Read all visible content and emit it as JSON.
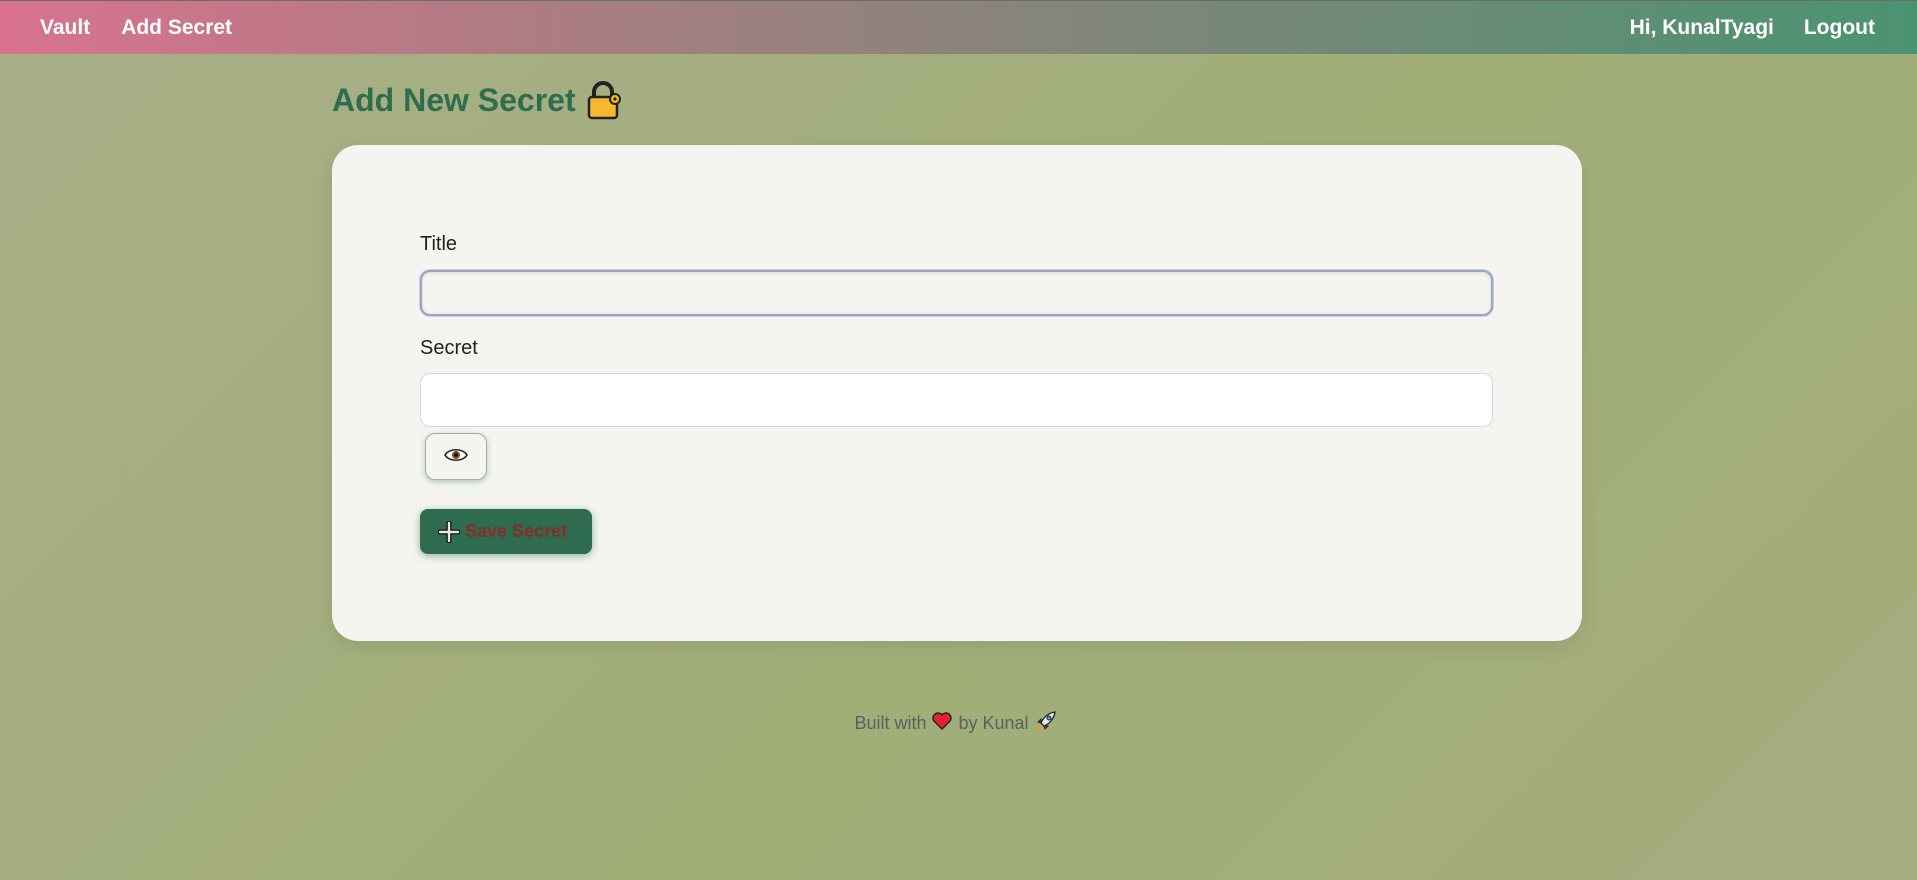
{
  "nav": {
    "vault_label": "Vault",
    "add_secret_label": "Add Secret",
    "greeting": "Hi, KunalTyagi",
    "logout_label": "Logout"
  },
  "page": {
    "title": "Add New Secret",
    "title_icon": "lock-icon"
  },
  "form": {
    "title_label": "Title",
    "title_value": "",
    "secret_label": "Secret",
    "secret_value": "",
    "toggle_visibility_icon": "eye-icon",
    "save_label": "Save Secret",
    "save_icon": "plus-icon"
  },
  "footer": {
    "built_with": "Built with",
    "by": "by Kunal",
    "heart_icon": "heart-icon",
    "rocket_icon": "rocket-icon"
  },
  "colors": {
    "nav_gradient_start": "#d9728f",
    "nav_gradient_end": "#4a9372",
    "accent_green": "#2f6b4f",
    "title_green": "#2e6e4e",
    "save_text": "#8a2a2a",
    "background": "#a3ad7d"
  }
}
